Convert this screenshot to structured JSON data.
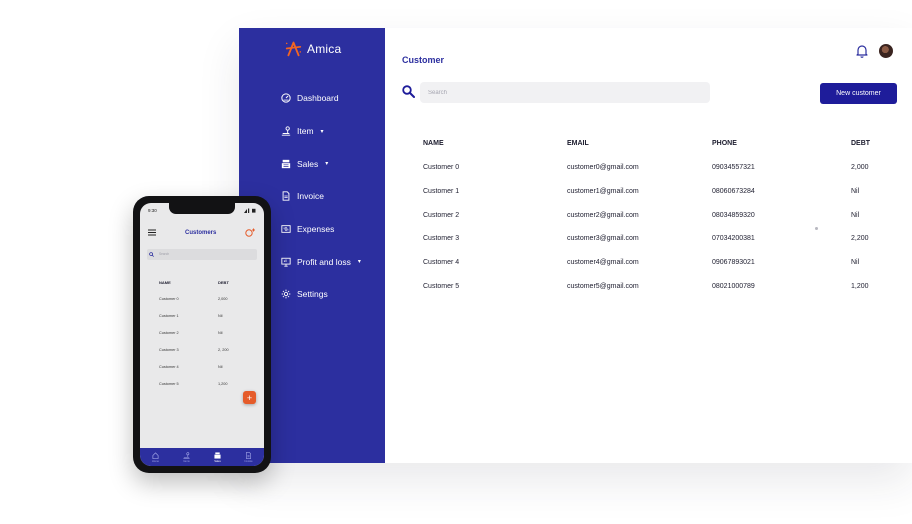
{
  "desktop": {
    "brand": {
      "name": "Amica",
      "accent": "#f26522"
    },
    "sidebar_color": "#2c2f9f",
    "nav": [
      {
        "label": "Dashboard",
        "icon": "dashboard-icon",
        "caret": ""
      },
      {
        "label": "Item",
        "icon": "item-icon",
        "caret": "▾"
      },
      {
        "label": "Sales",
        "icon": "cash-register-icon",
        "caret": "▾"
      },
      {
        "label": "Invoice",
        "icon": "invoice-icon",
        "caret": ""
      },
      {
        "label": "Expenses",
        "icon": "expenses-icon",
        "caret": ""
      },
      {
        "label": "Profit and loss",
        "icon": "monitor-icon",
        "caret": "▾"
      },
      {
        "label": "Settings",
        "icon": "gear-icon",
        "caret": ""
      }
    ],
    "header": {
      "title": "Customer"
    },
    "search": {
      "placeholder": "Search"
    },
    "new_button_label": "New customer",
    "table": {
      "columns": [
        "NAME",
        "EMAIL",
        "PHONE",
        "DEBT"
      ],
      "rows": [
        [
          "Customer 0",
          "customer0@gmail.com",
          "09034557321",
          "2,000"
        ],
        [
          "Customer 1",
          "customer1@gmail.com",
          "08060673284",
          "Nil"
        ],
        [
          "Customer 2",
          "customer2@gmail.com",
          "08034859320",
          "Nil"
        ],
        [
          "Customer 3",
          "customer3@gmail.com",
          "07034200381",
          "2,200"
        ],
        [
          "Customer 4",
          "customer4@gmail.com",
          "09067893021",
          "Nil"
        ],
        [
          "Customer 5",
          "customer5@gmail.com",
          "08021000789",
          "1,200"
        ]
      ]
    }
  },
  "phone": {
    "time": "9:30",
    "title": "Customers",
    "search_placeholder": "Search",
    "columns": [
      "NAME",
      "DEBT"
    ],
    "rows": [
      [
        "Customer 0",
        "2,000"
      ],
      [
        "Customer 1",
        "Nil"
      ],
      [
        "Customer 2",
        "Nil"
      ],
      [
        "Customer 3",
        "2, 200"
      ],
      [
        "Customer 4",
        "Nil"
      ],
      [
        "Customer 5",
        "1,200"
      ]
    ],
    "fab_label": "+",
    "tabs": [
      {
        "label": "Home",
        "icon": "home-icon"
      },
      {
        "label": "Items",
        "icon": "item-icon"
      },
      {
        "label": "Sales",
        "icon": "cash-register-icon"
      },
      {
        "label": "Invoice",
        "icon": "invoice-icon"
      }
    ],
    "active_tab": "Sales"
  }
}
